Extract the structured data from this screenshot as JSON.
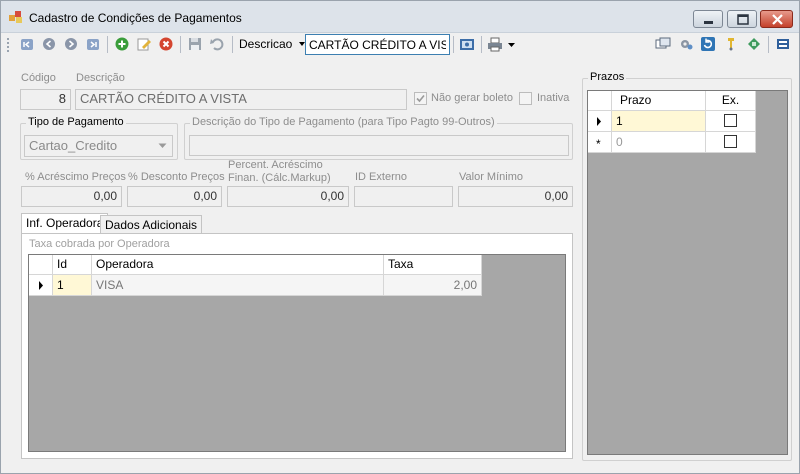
{
  "window": {
    "title": "Cadastro de Condições de Pagamentos"
  },
  "toolbar": {
    "search_field_label": "Descricao",
    "search_value": "CARTÃO CRÉDITO A VISTA"
  },
  "form": {
    "codigo_label": "Código",
    "codigo_value": "8",
    "descricao_label": "Descrição",
    "descricao_value": "CARTÃO CRÉDITO A VISTA",
    "nao_gerar_boleto_label": "Não gerar boleto",
    "nao_gerar_boleto_checked": true,
    "inativa_label": "Inativa",
    "inativa_checked": false,
    "tipo_pagamento_label": "Tipo de Pagamento",
    "tipo_pagamento_value": "Cartao_Credito",
    "desc_tipo_label": "Descrição do Tipo de Pagamento (para Tipo Pagto 99-Outros)",
    "desc_tipo_value": "",
    "acrescimo_label": "% Acréscimo Preços",
    "acrescimo_value": "0,00",
    "desconto_label": "% Desconto Preços",
    "desconto_value": "0,00",
    "percent_acrescimo_label_1": "Percent. Acréscimo",
    "percent_acrescimo_label_2": "Finan. (Cálc.Markup)",
    "percent_acrescimo_value": "0,00",
    "id_externo_label": "ID Externo",
    "id_externo_value": "",
    "valor_minimo_label": "Valor Mínimo",
    "valor_minimo_value": "0,00"
  },
  "tabs": [
    {
      "label": "Inf. Operadora",
      "active": true
    },
    {
      "label": "Dados Adicionais",
      "active": false
    }
  ],
  "operadora": {
    "caption": "Taxa cobrada por Operadora",
    "columns": [
      "Id",
      "Operadora",
      "Taxa"
    ],
    "rows": [
      {
        "id": "1",
        "operadora": "VISA",
        "taxa": "2,00"
      }
    ]
  },
  "prazos": {
    "title": "Prazos",
    "columns": [
      "Prazo",
      "Ex."
    ],
    "rows": [
      {
        "prazo": "1",
        "ex": false
      },
      {
        "prazo": "0",
        "ex": false
      }
    ]
  }
}
